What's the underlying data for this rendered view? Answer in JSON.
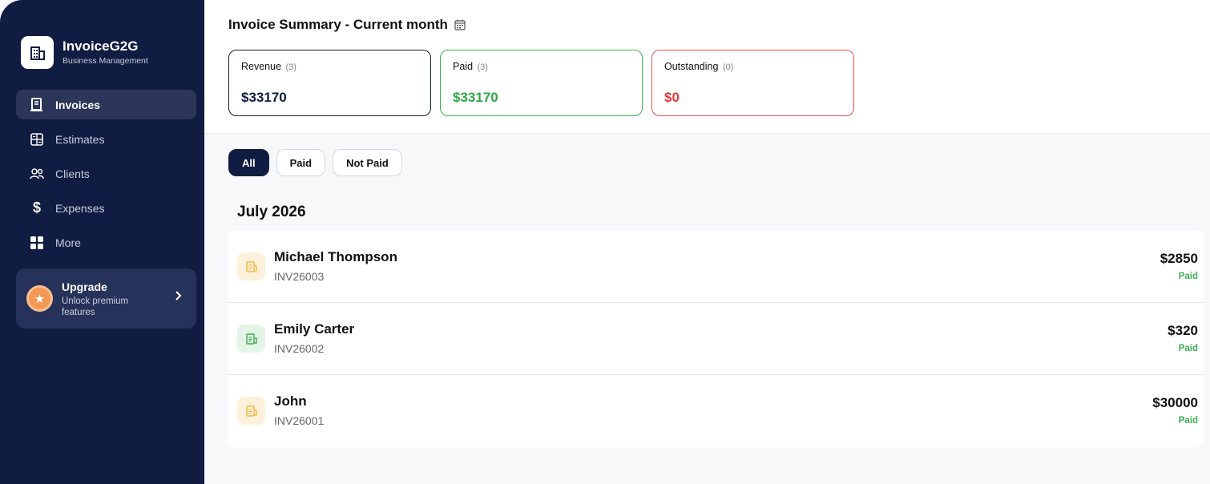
{
  "sidebar": {
    "brand": {
      "name": "InvoiceG2G",
      "subtitle": "Business Management"
    },
    "items": [
      {
        "label": "Invoices",
        "icon": "receipt-icon",
        "active": true
      },
      {
        "label": "Estimates",
        "icon": "calculator-icon"
      },
      {
        "label": "Clients",
        "icon": "users-icon"
      },
      {
        "label": "Expenses",
        "icon": "dollar-icon"
      },
      {
        "label": "More",
        "icon": "grid-icon"
      }
    ],
    "upgrade": {
      "title": "Upgrade",
      "subtitle": "Unlock premium features"
    }
  },
  "summary": {
    "title": "Invoice Summary - Current month",
    "cards": [
      {
        "label": "Revenue",
        "count": "(3)",
        "value": "$33170",
        "color": "#111c42"
      },
      {
        "label": "Paid",
        "count": "(3)",
        "value": "$33170",
        "color": "#2ea844"
      },
      {
        "label": "Outstanding",
        "count": "(0)",
        "value": "$0",
        "color": "#e23b3b"
      }
    ]
  },
  "filters": [
    {
      "label": "All",
      "active": true
    },
    {
      "label": "Paid"
    },
    {
      "label": "Not Paid"
    }
  ],
  "month": "July 2026",
  "invoices": [
    {
      "client": "Michael Thompson",
      "number": "INV26003",
      "amount": "$2850",
      "status": "Paid",
      "icon_color": "#f5b73f",
      "icon_bg": "#fdf1dc"
    },
    {
      "client": "Emily Carter",
      "number": "INV26002",
      "amount": "$320",
      "status": "Paid",
      "icon_color": "#3fae55",
      "icon_bg": "#e4f4e7"
    },
    {
      "client": "John",
      "number": "INV26001",
      "amount": "$30000",
      "status": "Paid",
      "icon_color": "#f5b73f",
      "icon_bg": "#fdf1dc"
    }
  ]
}
